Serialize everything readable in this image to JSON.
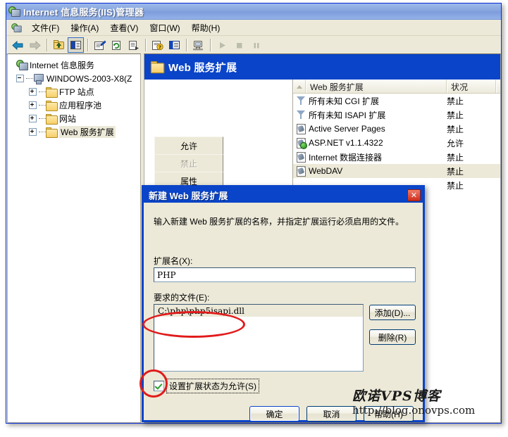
{
  "window": {
    "title": "Internet 信息服务(IIS)管理器",
    "icon": "iis-server-icon"
  },
  "menubar": {
    "items": [
      {
        "label": "文件(F)",
        "accel": "F",
        "name": "menu-file"
      },
      {
        "label": "操作(A)",
        "accel": "A",
        "name": "menu-action"
      },
      {
        "label": "查看(V)",
        "accel": "V",
        "name": "menu-view"
      },
      {
        "label": "窗口(W)",
        "accel": "W",
        "name": "menu-window"
      },
      {
        "label": "帮助(H)",
        "accel": "H",
        "name": "menu-help"
      }
    ]
  },
  "toolbar": {
    "buttons": [
      {
        "name": "back-icon",
        "glyph": "←",
        "enabled": true
      },
      {
        "name": "forward-icon",
        "glyph": "→",
        "enabled": false
      },
      {
        "name": "up-one-level-icon",
        "glyph": "↑",
        "enabled": true
      },
      {
        "name": "show-hide-console-tree-icon",
        "glyph": "▤",
        "enabled": true,
        "pressed": true
      },
      {
        "name": "properties-icon",
        "glyph": "☰",
        "enabled": true
      },
      {
        "name": "refresh-icon",
        "glyph": "↻",
        "enabled": true
      },
      {
        "name": "export-list-icon",
        "glyph": "≡",
        "enabled": true
      },
      {
        "name": "help-icon",
        "glyph": "?",
        "enabled": true
      },
      {
        "name": "detail-view-icon",
        "glyph": "▥",
        "enabled": true
      },
      {
        "name": "connect-computer-icon",
        "glyph": "⌨",
        "enabled": true
      },
      {
        "name": "start-icon",
        "glyph": "▶",
        "enabled": false
      },
      {
        "name": "stop-icon",
        "glyph": "■",
        "enabled": false
      },
      {
        "name": "pause-icon",
        "glyph": "‖",
        "enabled": false
      }
    ]
  },
  "tree": {
    "root": {
      "label": "Internet 信息服务",
      "icon": "iis-icon"
    },
    "server": {
      "label": "WINDOWS-2003-X8(Z",
      "icon": "local-computer-icon",
      "expander": "minus"
    },
    "children": [
      {
        "label": "FTP 站点",
        "icon": "folder-icon",
        "expander": "plus",
        "selected": false
      },
      {
        "label": "应用程序池",
        "icon": "folder-icon",
        "expander": "plus",
        "selected": false
      },
      {
        "label": "网站",
        "icon": "folder-icon",
        "expander": "plus",
        "selected": false
      },
      {
        "label": "Web 服务扩展",
        "icon": "folder-icon",
        "expander": "plus",
        "selected": true
      }
    ]
  },
  "right_pane": {
    "header": {
      "title": "Web 服务扩展",
      "icon": "folder-icon"
    },
    "actions": [
      {
        "label": "允许",
        "name": "allow-button",
        "enabled": true
      },
      {
        "label": "禁止",
        "name": "prohibit-button",
        "enabled": false
      },
      {
        "label": "属性",
        "name": "properties-button",
        "enabled": true
      }
    ],
    "list": {
      "columns": [
        "",
        "Web 服务扩展",
        "状况",
        ""
      ],
      "rows": [
        {
          "icon": "filter-icon",
          "name": "所有未知 CGI 扩展",
          "status": "禁止",
          "selected": false
        },
        {
          "icon": "filter-icon",
          "name": "所有未知 ISAPI 扩展",
          "status": "禁止",
          "selected": false
        },
        {
          "icon": "extension-doc-icon",
          "name": "Active Server Pages",
          "status": "禁止",
          "selected": false
        },
        {
          "icon": "extension-doc-enabled-icon",
          "name": "ASP.NET v1.1.4322",
          "status": "允许",
          "selected": false
        },
        {
          "icon": "extension-doc-icon",
          "name": "Internet 数据连接器",
          "status": "禁止",
          "selected": false
        },
        {
          "icon": "extension-doc-icon",
          "name": "WebDAV",
          "status": "禁止",
          "selected": true
        },
        {
          "icon": "extension-doc-icon",
          "name": "",
          "status": "禁止",
          "selected": false
        }
      ]
    }
  },
  "dialog": {
    "title": "新建 Web 服务扩展",
    "close_label": "✕",
    "description": "输入新建 Web 服务扩展的名称，并指定扩展运行必须启用的文件。",
    "extension_name_label": "扩展名(X):",
    "extension_name_value": "PHP",
    "required_files_label": "要求的文件(E):",
    "required_files": [
      "C:\\php\\php5isapi.dll"
    ],
    "add_button": "添加(D)...",
    "remove_button": "删除(R)",
    "set_allowed_checkbox": "设置扩展状态为允许(S)",
    "set_allowed_checked": true,
    "ok_button": "确定",
    "cancel_button": "取消",
    "help_button": "帮助(H)"
  },
  "watermark": {
    "line1": "欧诺VPS博客",
    "line2": "http://blog.onovps.com"
  },
  "colors": {
    "title_bar": "#8ba9e0",
    "dialog_accent": "#0a44c8",
    "header_blue": "#0a44c8",
    "face": "#ece9d8",
    "annotation_red": "#e11b1b"
  }
}
